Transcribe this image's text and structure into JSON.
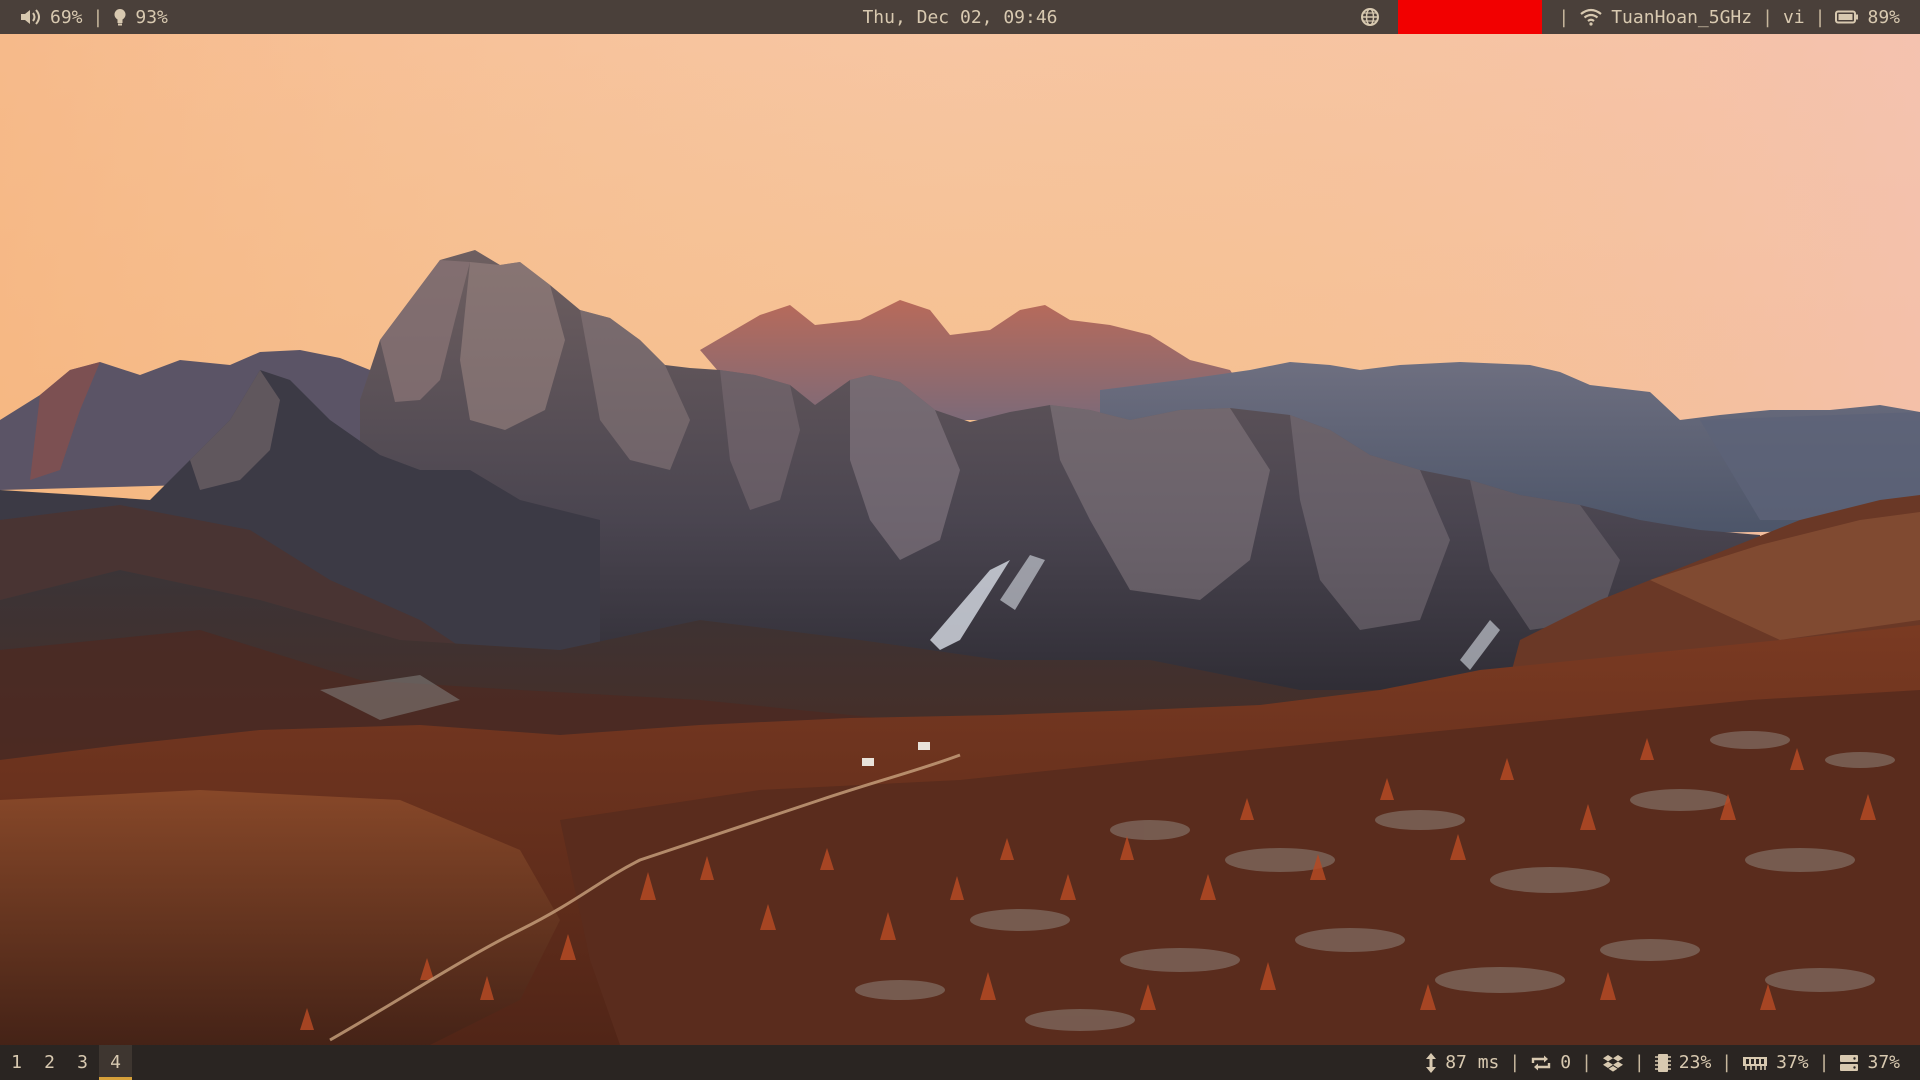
{
  "top_bar": {
    "volume": "69%",
    "brightness": "93%",
    "datetime": "Thu, Dec 02, 09:46",
    "wifi_ssid": "TuanHoan_5GHz",
    "keyboard_layout": "vi",
    "battery": "89%",
    "redacted_color": "#f20000",
    "separator": "|"
  },
  "bottom_bar": {
    "workspaces": [
      "1",
      "2",
      "3",
      "4"
    ],
    "active_workspace": "4",
    "ping": "87 ms",
    "updates": "0",
    "cpu": "23%",
    "memory": "37%",
    "disk": "37%",
    "separator": "|"
  },
  "icons": {
    "volume": "speaker-icon",
    "brightness": "bulb-icon",
    "network": "globe-icon",
    "wifi": "wifi-icon",
    "battery": "battery-icon",
    "ping": "updown-arrow-icon",
    "updates": "refresh-icon",
    "dropbox": "dropbox-icon",
    "cpu": "cpu-icon",
    "memory": "memory-icon",
    "disk": "disk-icon"
  },
  "colors": {
    "top_bar_bg": "#4a403a",
    "bottom_bar_bg": "#2a2522",
    "text": "#d8c9b0",
    "active_workspace_underline": "#d7a13a"
  }
}
